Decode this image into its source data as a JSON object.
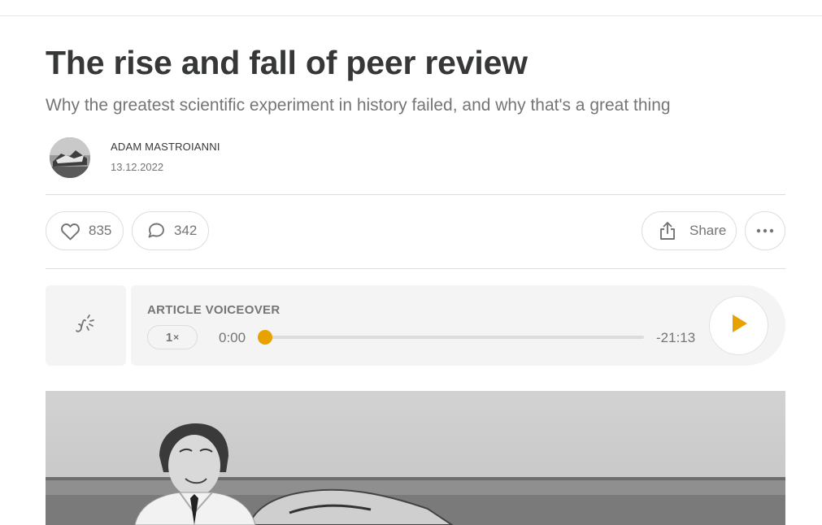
{
  "article": {
    "title": "The rise and fall of peer review",
    "subtitle": "Why the greatest scientific experiment in history failed, and why that's a great thing"
  },
  "author": {
    "name": "ADAM MASTROIANNI",
    "date": "13.12.2022"
  },
  "actions": {
    "likes": "835",
    "comments": "342",
    "share_label": "Share"
  },
  "voiceover": {
    "label": "ARTICLE VOICEOVER",
    "speed_value": "1",
    "speed_suffix": "×",
    "elapsed": "0:00",
    "remaining": "-21:13",
    "progress": 0.0
  },
  "icons": {
    "like": "heart-icon",
    "comment": "comment-icon",
    "share": "share-icon",
    "more": "more-icon",
    "voiceover": "voiceover-icon",
    "play": "play-icon"
  },
  "colors": {
    "accent": "#e8a200",
    "text": "#363737",
    "muted": "#757575",
    "panel": "#f4f4f4"
  }
}
